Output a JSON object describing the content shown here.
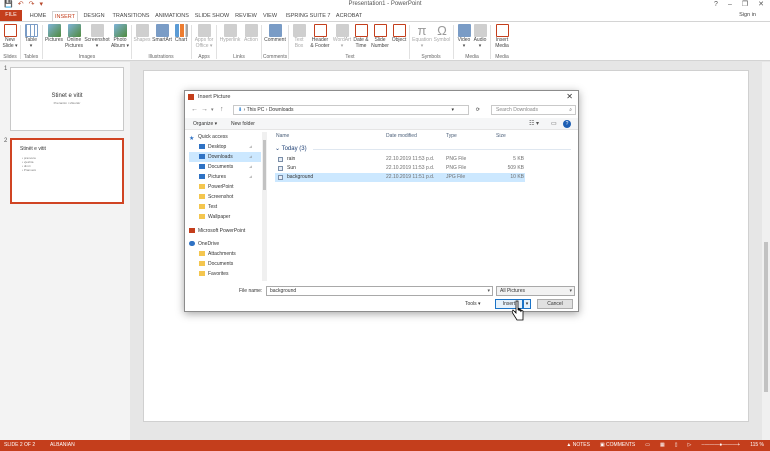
{
  "window": {
    "title": "Presentation1 - PowerPoint",
    "help": "?",
    "minimize": "–",
    "restore": "❐",
    "close": "✕",
    "signin": "Sign in",
    "qat": [
      "💾",
      "↶",
      "↷",
      "▾"
    ]
  },
  "tabs": [
    {
      "label": "FILE"
    },
    {
      "label": "HOME"
    },
    {
      "label": "INSERT"
    },
    {
      "label": "DESIGN"
    },
    {
      "label": "TRANSITIONS"
    },
    {
      "label": "ANIMATIONS"
    },
    {
      "label": "SLIDE SHOW"
    },
    {
      "label": "REVIEW"
    },
    {
      "label": "VIEW"
    },
    {
      "label": "ISPRING SUITE 7"
    },
    {
      "label": "ACROBAT"
    }
  ],
  "ribbon": {
    "buttons": [
      {
        "label": "New\nSlide ▾",
        "icon": "new-slide-icon"
      },
      {
        "label": "Table\n▾",
        "icon": "table-icon"
      },
      {
        "label": "Pictures",
        "icon": "pictures-icon"
      },
      {
        "label": "Online\nPictures",
        "icon": "online-pictures-icon"
      },
      {
        "label": "Screenshot\n▾",
        "icon": "screenshot-icon"
      },
      {
        "label": "Photo\nAlbum ▾",
        "icon": "photo-album-icon"
      },
      {
        "label": "Shapes",
        "icon": "shapes-icon"
      },
      {
        "label": "SmartArt",
        "icon": "smartart-icon"
      },
      {
        "label": "Chart",
        "icon": "chart-icon"
      },
      {
        "label": "Apps for\nOffice ▾",
        "icon": "apps-icon"
      },
      {
        "label": "Hyperlink",
        "icon": "hyperlink-icon"
      },
      {
        "label": "Action",
        "icon": "action-icon"
      },
      {
        "label": "Comment",
        "icon": "comment-icon"
      },
      {
        "label": "Text\nBox",
        "icon": "textbox-icon"
      },
      {
        "label": "Header\n& Footer",
        "icon": "header-footer-icon"
      },
      {
        "label": "WordArt\n▾",
        "icon": "wordart-icon"
      },
      {
        "label": "Date &\nTime",
        "icon": "date-time-icon"
      },
      {
        "label": "Slide\nNumber",
        "icon": "slide-number-icon"
      },
      {
        "label": "Object",
        "icon": "object-icon"
      },
      {
        "label": "Equation\n▾",
        "icon": "equation-icon"
      },
      {
        "label": "Symbol",
        "icon": "symbol-icon"
      },
      {
        "label": "Video\n▾",
        "icon": "video-icon"
      },
      {
        "label": "Audio\n▾",
        "icon": "audio-icon"
      },
      {
        "label": "Insert\nMedia",
        "icon": "insert-media-icon"
      }
    ],
    "groups": [
      "Slides",
      "Tables",
      "Images",
      "Illustrations",
      "Apps",
      "Links",
      "Comments",
      "Text",
      "Symbols",
      "Media",
      "Media"
    ]
  },
  "thumbnails": [
    {
      "num": "1",
      "title": "Stinet e vitit",
      "subtitle": "Prezantim i shkurtër"
    },
    {
      "num": "2",
      "title": "Stinët e vitit",
      "bullets": [
        "• pranvera",
        "• vjeshta",
        "• dimri",
        "• Pranverë"
      ]
    }
  ],
  "dialog": {
    "title": "Insert Picture",
    "close": "✕",
    "nav_back": "←",
    "nav_forward": "→",
    "nav_recent": "▾",
    "nav_up": "↑",
    "address": {
      "loc_icon": "⬇",
      "sep1": "›",
      "pc": "This PC",
      "sep2": "›",
      "folder": "Downloads",
      "dropdown": "▾",
      "refresh": "⟳"
    },
    "search_placeholder": "Search Downloads",
    "search_icon": "⌕",
    "organize": "Organize ▾",
    "new_folder": "New folder",
    "view_icons": [
      "☷ ▾",
      "▭"
    ],
    "help": "?",
    "nav_items": [
      {
        "label": "Quick access",
        "icon": "star-icon",
        "pinned": false
      },
      {
        "label": "Desktop",
        "icon": "desktop-icon",
        "pinned": true
      },
      {
        "label": "Downloads",
        "icon": "downloads-icon",
        "pinned": true,
        "selected": true
      },
      {
        "label": "Documents",
        "icon": "documents-icon",
        "pinned": true
      },
      {
        "label": "Pictures",
        "icon": "pictures-folder-icon",
        "pinned": true
      },
      {
        "label": "PowerPoint",
        "icon": "folder-icon",
        "pinned": false
      },
      {
        "label": "Screenshot",
        "icon": "folder-icon",
        "pinned": false
      },
      {
        "label": "Test",
        "icon": "folder-icon",
        "pinned": false
      },
      {
        "label": "Wallpaper",
        "icon": "folder-icon",
        "pinned": false
      },
      {
        "label": "Microsoft PowerPoint",
        "icon": "powerpoint-icon",
        "pinned": false
      },
      {
        "label": "OneDrive",
        "icon": "onedrive-icon",
        "pinned": false
      },
      {
        "label": "Attachments",
        "icon": "folder-icon",
        "pinned": false
      },
      {
        "label": "Documents",
        "icon": "folder-icon",
        "pinned": false
      },
      {
        "label": "Favorites",
        "icon": "folder-icon",
        "pinned": false
      }
    ],
    "pin_glyph": "⊿",
    "columns": {
      "name": "Name",
      "date": "Date modified",
      "type": "Type",
      "size": "Size"
    },
    "group_label": "⌄ Today (3)",
    "files": [
      {
        "name": "rain",
        "date": "22.10.2019 11:53 p.d.",
        "type": "PNG File",
        "size": "5 KB"
      },
      {
        "name": "Sun",
        "date": "22.10.2019 11:53 p.d.",
        "type": "PNG File",
        "size": "509 KB"
      },
      {
        "name": "background",
        "date": "22.10.2019 11:51 p.d.",
        "type": "JPG File",
        "size": "10 KB",
        "selected": true
      }
    ],
    "filename_label": "File name:",
    "filename_value": "background",
    "filter_value": "All Pictures",
    "tools": "Tools ▾",
    "insert": "Insert",
    "cancel": "Cancel",
    "dropdown": "▾"
  },
  "status": {
    "slide": "SLIDE 2 OF 2",
    "language": "ALBANIAN",
    "notes": "▲ NOTES",
    "comments": "▣ COMMENTS",
    "zoom": "115 %"
  }
}
